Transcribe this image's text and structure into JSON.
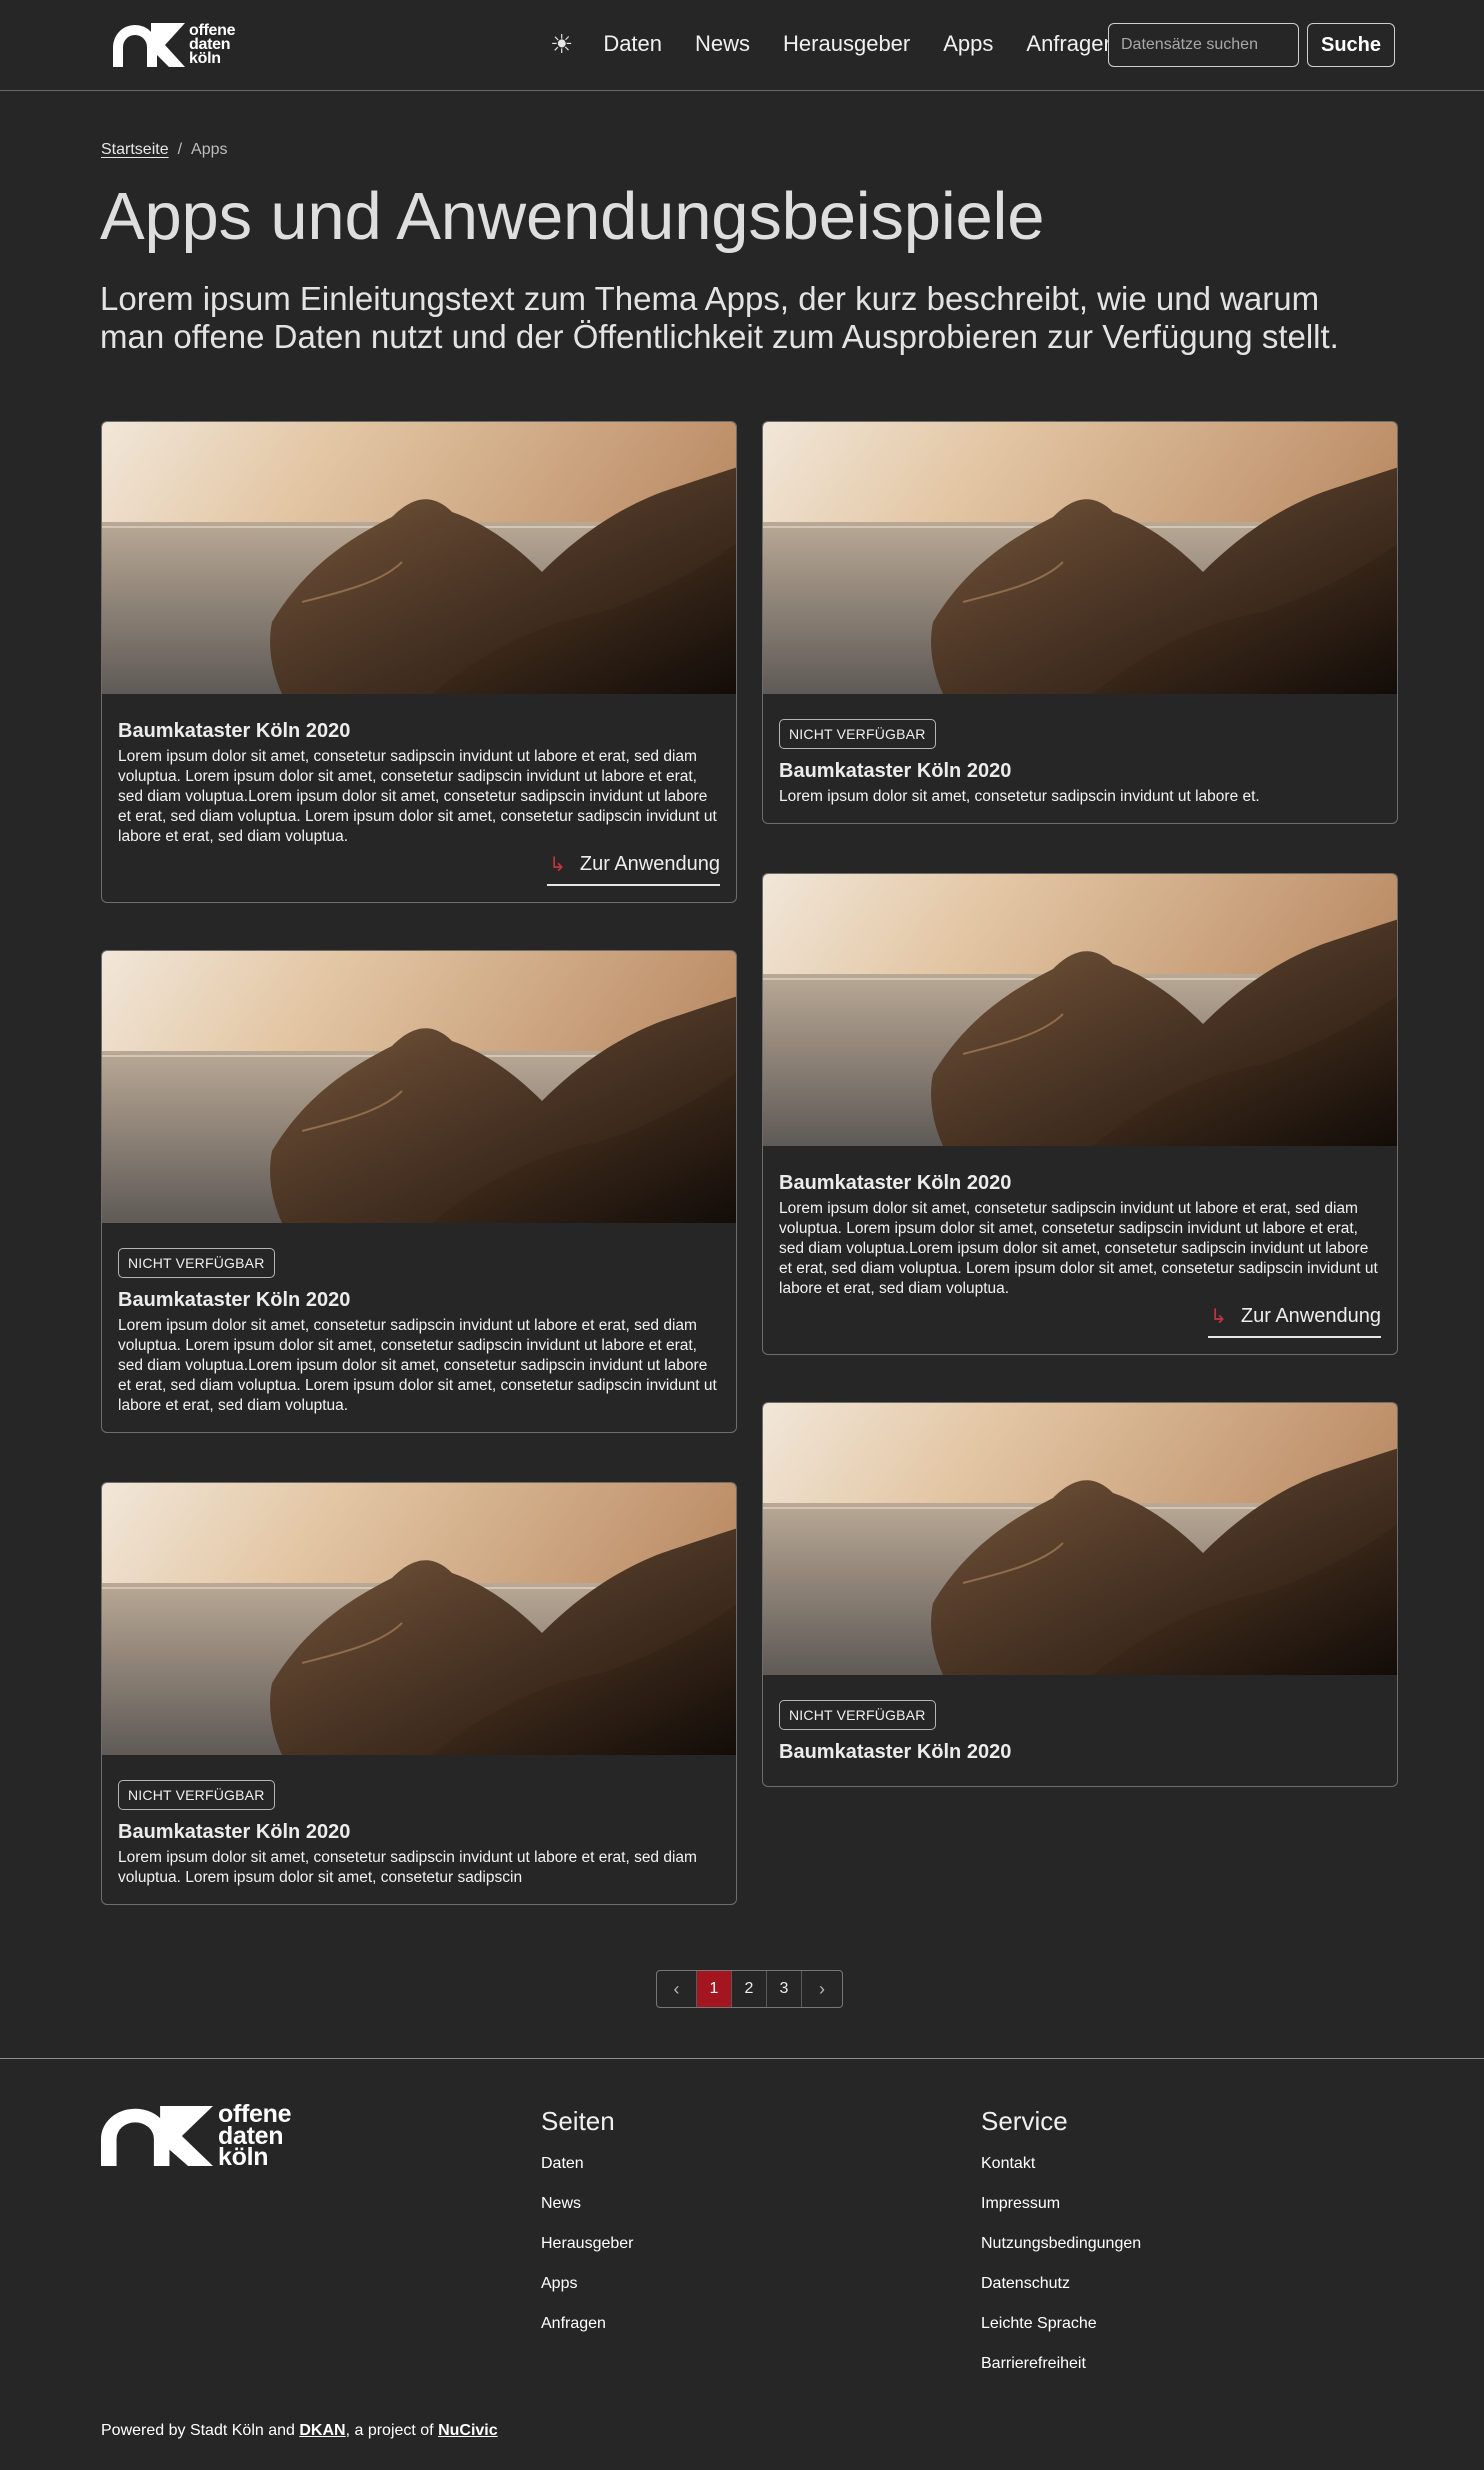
{
  "header": {
    "logo_lines": [
      "offene",
      "daten",
      "köln"
    ],
    "theme_icon": "sun-icon",
    "nav": [
      "Daten",
      "News",
      "Herausgeber",
      "Apps",
      "Anfragen"
    ],
    "search_placeholder": "Datensätze suchen",
    "search_button": "Suche"
  },
  "breadcrumb": {
    "home": "Startseite",
    "separator": "/",
    "current": "Apps"
  },
  "title": "Apps und Anwendungsbeispiele",
  "intro": "Lorem ipsum Einleitungstext zum Thema Apps, der kurz beschreibt, wie und warum man offene Daten nutzt und der Öffentlichkeit zum Ausprobieren zur Verfügung stellt.",
  "cards": [
    {
      "badge": "",
      "title": "Baumkataster Köln 2020",
      "text": "Lorem ipsum dolor sit amet, consetetur sadipscin invidunt ut labore et erat, sed diam voluptua. Lorem ipsum dolor sit amet, consetetur sadipscin invidunt ut labore et erat, sed diam voluptua.Lorem ipsum dolor sit amet, consetetur sadipscin invidunt ut labore et erat, sed diam voluptua. Lorem ipsum dolor sit amet, consetetur sadipscin invidunt ut labore et erat, sed diam voluptua.",
      "link": "Zur Anwendung"
    },
    {
      "badge": "NICHT VERFÜGBAR",
      "title": "Baumkataster Köln 2020",
      "text": "Lorem ipsum dolor sit amet, consetetur sadipscin invidunt ut labore et.",
      "link": ""
    },
    {
      "badge": "NICHT VERFÜGBAR",
      "title": "Baumkataster Köln 2020",
      "text": "Lorem ipsum dolor sit amet, consetetur sadipscin invidunt ut labore et erat, sed diam voluptua. Lorem ipsum dolor sit amet, consetetur sadipscin invidunt ut labore et erat, sed diam voluptua.Lorem ipsum dolor sit amet, consetetur sadipscin invidunt ut labore et erat, sed diam voluptua. Lorem ipsum dolor sit amet, consetetur sadipscin invidunt ut labore et erat, sed diam voluptua.",
      "link": ""
    },
    {
      "badge": "",
      "title": "Baumkataster Köln 2020",
      "text": "Lorem ipsum dolor sit amet, consetetur sadipscin invidunt ut labore et erat, sed diam voluptua. Lorem ipsum dolor sit amet, consetetur sadipscin invidunt ut labore et erat, sed diam voluptua.Lorem ipsum dolor sit amet, consetetur sadipscin invidunt ut labore et erat, sed diam voluptua. Lorem ipsum dolor sit amet, consetetur sadipscin invidunt ut labore et erat, sed diam voluptua.",
      "link": "Zur Anwendung"
    },
    {
      "badge": "NICHT VERFÜGBAR",
      "title": "Baumkataster Köln 2020",
      "text": "Lorem ipsum dolor sit amet, consetetur sadipscin invidunt ut labore et erat, sed diam voluptua. Lorem ipsum dolor sit amet, consetetur sadipscin",
      "link": ""
    },
    {
      "badge": "NICHT VERFÜGBAR",
      "title": "Baumkataster Köln 2020",
      "text": "",
      "link": ""
    }
  ],
  "pagination": {
    "prev_icon": "chevron-left-icon",
    "pages": [
      "1",
      "2",
      "3"
    ],
    "current": "1",
    "next_icon": "chevron-right-icon"
  },
  "footer": {
    "logo_lines": [
      "offene",
      "daten",
      "köln"
    ],
    "pages_heading": "Seiten",
    "pages_links": [
      "Daten",
      "News",
      "Herausgeber",
      "Apps",
      "Anfragen"
    ],
    "service_heading": "Service",
    "service_links": [
      "Kontakt",
      "Impressum",
      "Nutzungsbedingungen",
      "Datenschutz",
      "Leichte Sprache",
      "Barrierefreiheit"
    ],
    "powered_prefix": "Powered by Stadt Köln and ",
    "powered_link1": "DKAN",
    "powered_mid": ", a project of ",
    "powered_link2": "NuCivic"
  },
  "colors": {
    "background": "#262626",
    "accent": "#a3151f",
    "text": "#e6e6e6"
  }
}
